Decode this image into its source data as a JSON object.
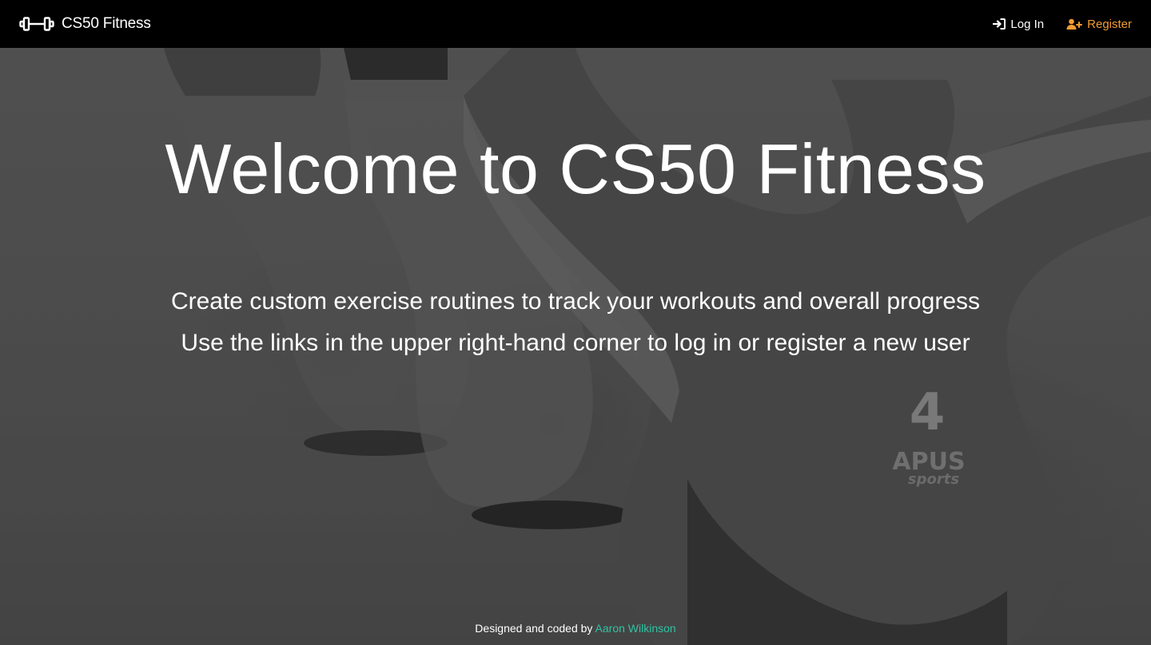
{
  "nav": {
    "brand": "CS50 Fitness",
    "brand_icon": "dumbbell-icon",
    "login_label": "Log In",
    "login_icon": "sign-in-icon",
    "register_label": "Register",
    "register_icon": "user-plus-icon",
    "register_color": "#f39c33"
  },
  "hero": {
    "title": "Welcome to CS50 Fitness",
    "line1": "Create custom exercise routines to track your workouts and overall progress",
    "line2": "Use the links in the upper right-hand corner to log in or register a new user",
    "background": "kettlebells-photo",
    "kettlebell_number": "4",
    "kettlebell_brand": "APUS",
    "kettlebell_brand_sub": "sports"
  },
  "footer": {
    "prefix": "Designed and coded by",
    "author": "Aaron Wilkinson",
    "author_color": "#2ec4a3"
  }
}
